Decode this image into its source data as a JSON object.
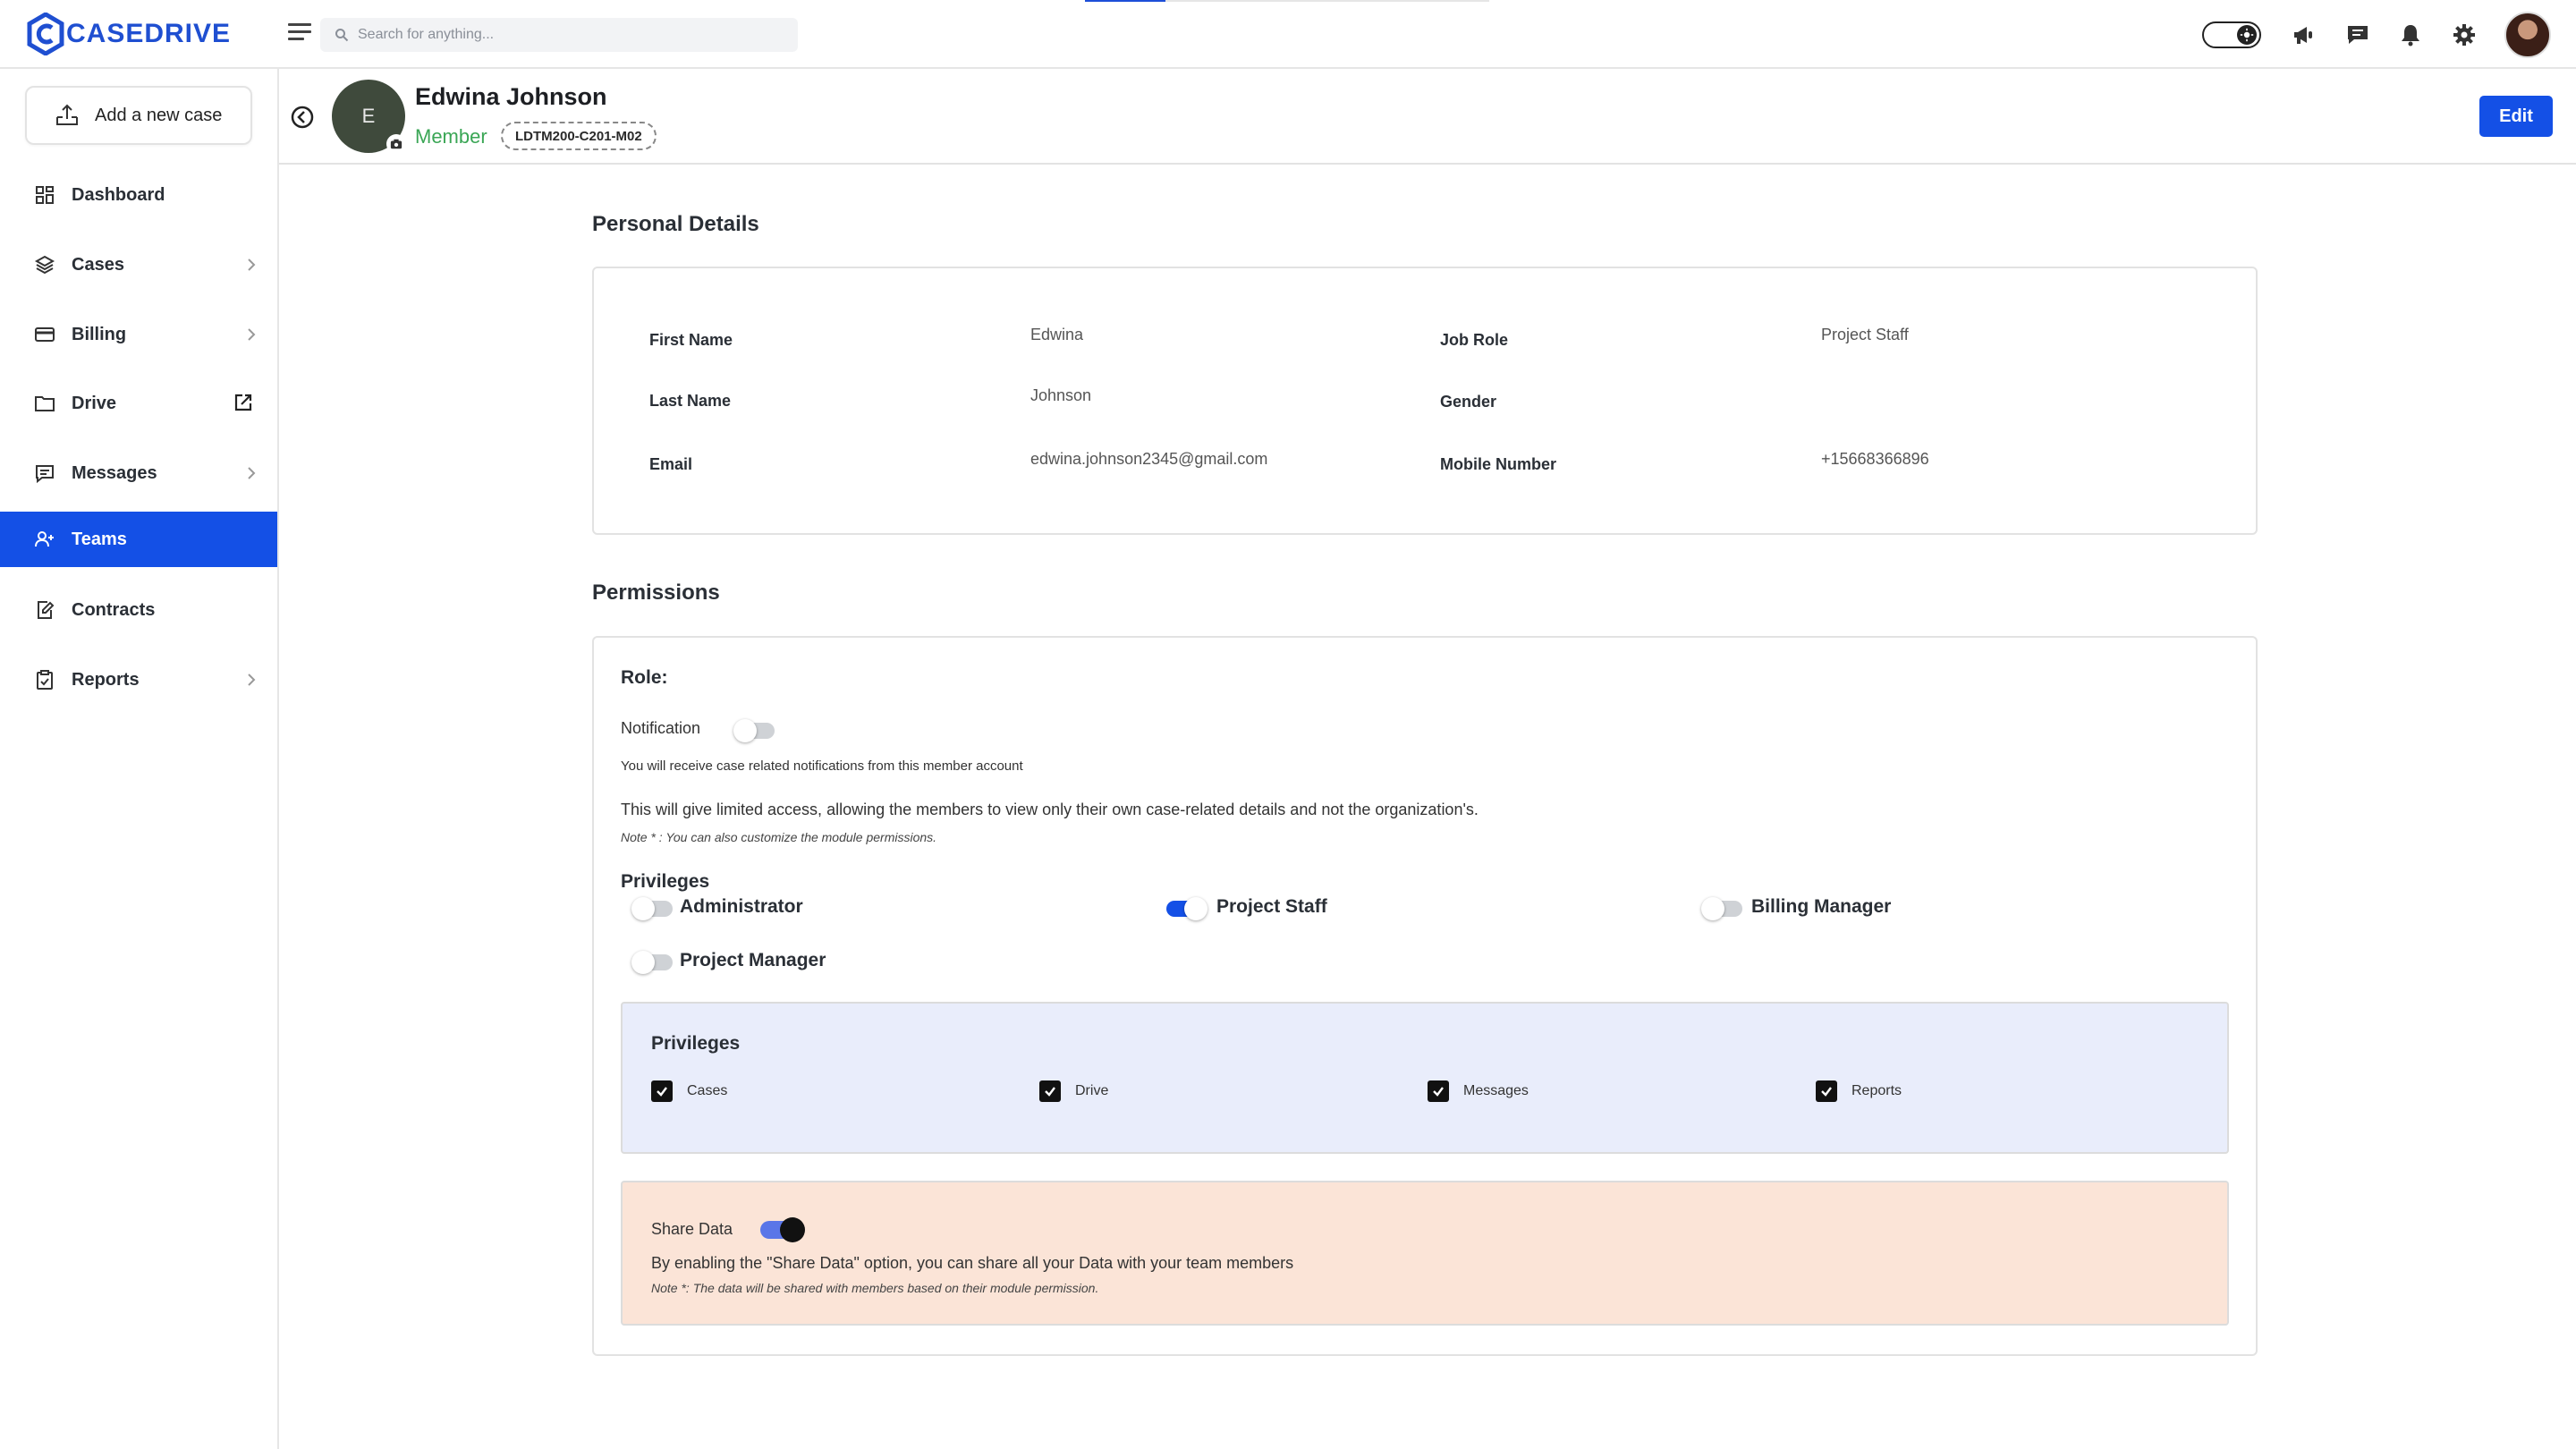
{
  "app": {
    "name": "CASEDRIVE"
  },
  "search": {
    "placeholder": "Search for anything..."
  },
  "sidebar": {
    "add_case_label": "Add a new case",
    "items": [
      {
        "label": "Dashboard",
        "icon": "dashboard-icon",
        "chevron": false
      },
      {
        "label": "Cases",
        "icon": "layers-icon",
        "chevron": true
      },
      {
        "label": "Billing",
        "icon": "credit-card-icon",
        "chevron": true
      },
      {
        "label": "Drive",
        "icon": "folder-icon",
        "external": true
      },
      {
        "label": "Messages",
        "icon": "message-icon",
        "chevron": true
      },
      {
        "label": "Teams",
        "icon": "team-icon",
        "active": true
      },
      {
        "label": "Contracts",
        "icon": "contract-icon",
        "chevron": false
      },
      {
        "label": "Reports",
        "icon": "report-icon",
        "chevron": true
      }
    ]
  },
  "profile": {
    "initial": "E",
    "name": "Edwina Johnson",
    "role": "Member",
    "code": "LDTM200-C201-M02",
    "edit_label": "Edit"
  },
  "personal": {
    "title": "Personal Details",
    "first_name_label": "First Name",
    "first_name": "Edwina",
    "last_name_label": "Last Name",
    "last_name": "Johnson",
    "email_label": "Email",
    "email": "edwina.johnson2345@gmail.com",
    "job_role_label": "Job Role",
    "job_role": "Project Staff",
    "gender_label": "Gender",
    "gender": "",
    "mobile_label": "Mobile Number",
    "mobile": "+15668366896"
  },
  "permissions": {
    "title": "Permissions",
    "role_label": "Role:",
    "notification_label": "Notification",
    "notification_enabled": false,
    "notification_help": "You will receive case related notifications from this member account",
    "access_text": "This will give limited access, allowing the members to view only their own case-related details and not the organization's.",
    "note": "Note * : You can also customize the module permissions.",
    "privileges_title": "Privileges",
    "roles": [
      {
        "label": "Administrator",
        "enabled": false
      },
      {
        "label": "Project Staff",
        "enabled": true
      },
      {
        "label": "Billing Manager",
        "enabled": false
      },
      {
        "label": "Project Manager",
        "enabled": false
      }
    ],
    "modules_title": "Privileges",
    "modules": [
      {
        "label": "Cases",
        "checked": true
      },
      {
        "label": "Drive",
        "checked": true
      },
      {
        "label": "Messages",
        "checked": true
      },
      {
        "label": "Reports",
        "checked": true
      }
    ],
    "share_label": "Share Data",
    "share_enabled": true,
    "share_desc": "By enabling the \"Share Data\" option, you can share all your Data with your team members",
    "share_note": "Note *: The data will be shared with members based on their module permission."
  },
  "colors": {
    "brand": "#1f4fd1",
    "accent": "#1450e6",
    "member_green": "#3aa655",
    "modules_bg": "#e9edfb",
    "share_bg": "#fbe4d7"
  }
}
